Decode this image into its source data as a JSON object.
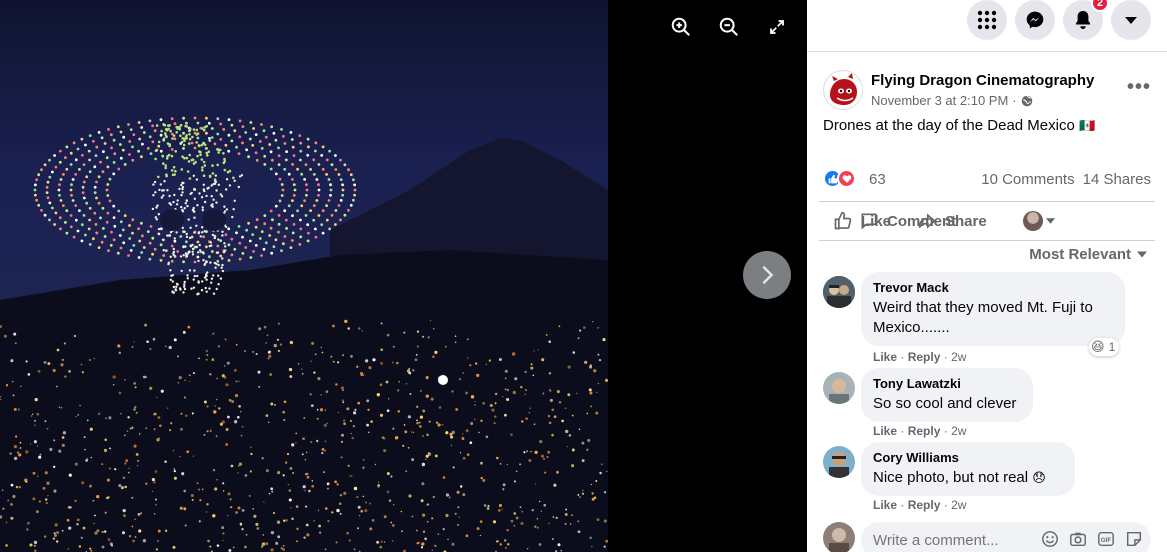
{
  "viewer": {
    "tools": [
      {
        "name": "zoom-in-icon"
      },
      {
        "name": "zoom-out-icon"
      },
      {
        "name": "fullscreen-icon"
      }
    ],
    "next": "chevron-right-icon"
  },
  "topbar": {
    "notifications_count": "2"
  },
  "post": {
    "page_name": "Flying Dragon Cinematography",
    "time": "November 3 at 2:10 PM",
    "dot": "·",
    "text": "Drones at the day of the Dead Mexico",
    "flag": "🇲🇽",
    "reactions_count": "63",
    "comments_count": "10 Comments",
    "shares_count": "14 Shares"
  },
  "actions": {
    "like": "Like",
    "comment": "Comment",
    "share": "Share"
  },
  "sort_label": "Most Relevant",
  "comments": [
    {
      "name": "Trevor Mack",
      "text": "Weird that they moved Mt. Fuji to Mexico.......",
      "like": "Like",
      "reply": "Reply",
      "sep": "·",
      "age": "2w",
      "reaction_count": "1",
      "reaction": "😆"
    },
    {
      "name": "Tony Lawatzki",
      "text": "So so cool and clever",
      "like": "Like",
      "reply": "Reply",
      "sep": "·",
      "age": "2w"
    },
    {
      "name": "Cory Williams",
      "text": "Nice photo, but not real",
      "emoji": "😞",
      "like": "Like",
      "reply": "Reply",
      "sep": "·",
      "age": "2w"
    }
  ],
  "write_comment": {
    "placeholder": "Write a comment..."
  },
  "colors": {
    "accent": "#1877f2",
    "love": "#f33e58",
    "badge": "#e41e3f"
  }
}
